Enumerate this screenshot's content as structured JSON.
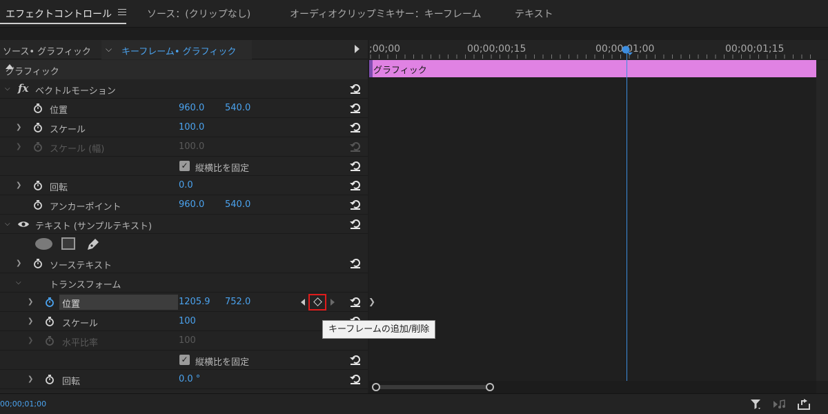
{
  "tabs": [
    {
      "label": "エフェクトコントロール",
      "active": true
    },
    {
      "label": "ソース：(クリップなし)"
    },
    {
      "label": "オーディオクリップミキサー：キーフレーム"
    },
    {
      "label": "テキスト"
    }
  ],
  "breadcrumb": {
    "source": "ソース• グラフィック",
    "keyframe": "キーフレーム• グラフィック"
  },
  "section": {
    "title": "グラフィック"
  },
  "rows": {
    "vector_motion": {
      "label": "ベクトルモーション",
      "icon": "fx-icon"
    },
    "position": {
      "label": "位置",
      "x": "960.0",
      "y": "540.0"
    },
    "scale": {
      "label": "スケール",
      "value": "100.0"
    },
    "scale_width": {
      "label": "スケール (幅)",
      "value": "100.0"
    },
    "uniform_scale_1": {
      "label": "縦横比を固定",
      "checked": true
    },
    "rotation": {
      "label": "回転",
      "value": "0.0"
    },
    "anchor": {
      "label": "アンカーポイント",
      "x": "960.0",
      "y": "540.0"
    },
    "text_layer": {
      "label": "テキスト (サンプルテキスト)"
    },
    "source_text": {
      "label": "ソーステキスト"
    },
    "transform": {
      "label": "トランスフォーム"
    },
    "t_position": {
      "label": "位置",
      "x": "1205.9",
      "y": "752.0"
    },
    "t_scale": {
      "label": "スケール",
      "value": "100"
    },
    "t_hscale": {
      "label": "水平比率",
      "value": "100"
    },
    "uniform_scale_2": {
      "label": "縦横比を固定",
      "checked": true
    },
    "t_rotation": {
      "label": "回転",
      "value": "0.0 °"
    }
  },
  "tooltip": {
    "text": "キーフレームの追加/削除"
  },
  "timeline": {
    "ruler_labels": [
      ";00;00",
      "00;00;00;15",
      "00;00;01;00",
      "00;00;01;15"
    ],
    "clip_label": "グラフィック"
  },
  "bottom": {
    "timecode": "00;00;01;00"
  },
  "colors": {
    "accent": "#4ba3ef",
    "clip": "#e082e3",
    "highlight": "#e01b1b",
    "playhead": "#3d8ee0"
  }
}
